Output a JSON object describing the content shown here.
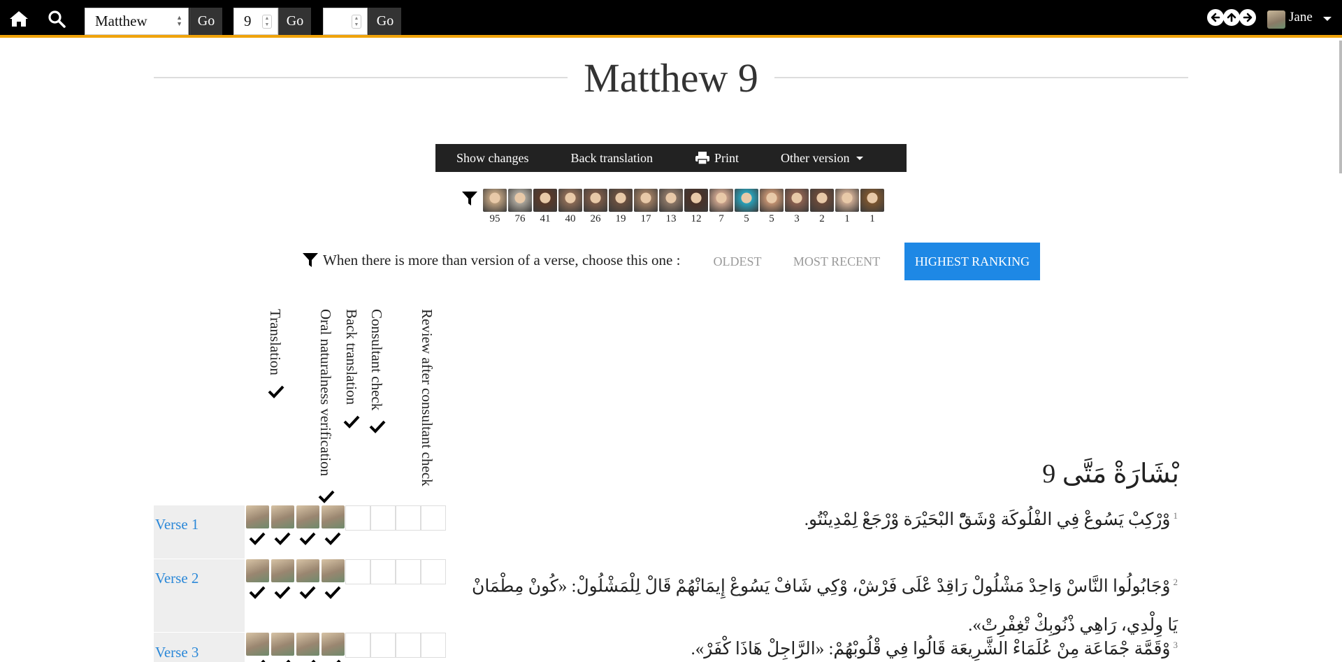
{
  "nav": {
    "book_value": "Matthew",
    "chapter_value": "9",
    "verse_value": "",
    "go_label": "Go",
    "user_name": "Jane"
  },
  "page": {
    "title": "Matthew 9"
  },
  "toolbar": {
    "show_changes": "Show changes",
    "back_translation": "Back translation",
    "print": "Print",
    "other_version": "Other version"
  },
  "contributors": {
    "counts": [
      "95",
      "76",
      "41",
      "40",
      "26",
      "19",
      "17",
      "13",
      "12",
      "7",
      "5",
      "5",
      "3",
      "2",
      "1",
      "1"
    ],
    "colors": [
      "#b89c7c",
      "#a9a49a",
      "#5a3a2a",
      "#8a6a55",
      "#7a5a48",
      "#6a5040",
      "#9a7a60",
      "#8a7565",
      "#4a3228",
      "#c7a08a",
      "#2aa0b8",
      "#c09070",
      "#8a6050",
      "#6a4a3a",
      "#c9a890",
      "#7a5530"
    ]
  },
  "version_choice": {
    "prompt": "When there is more than version of a verse, choose this one :",
    "oldest": "OLDEST",
    "most_recent": "MOST RECENT",
    "highest_ranking": "HIGHEST RANKING",
    "selected": "HIGHEST RANKING"
  },
  "stages": {
    "translation": "Translation",
    "oral": "Oral naturalness verification",
    "back": "Back translation",
    "consultant": "Consultant check",
    "review": "Review after consultant check"
  },
  "chapter": {
    "heading": "بْشَارَةْ مَتَّى 9"
  },
  "verses": [
    {
      "label": "Verse 1",
      "number": "1",
      "text": "وْرْكِبْ يَسُوعْ فِي الفْلُوكَة وْشَقّْ البْحَيْرَة وْرْجَعْ لِمْدِينْتُو."
    },
    {
      "label": "Verse 2",
      "number": "2",
      "text": "وْجَابُولُوا النَّاسْ وَاحِدْ مَشْلُولْ رَاقِدْ عْلَى فَرْشْ، وْكِي شَافْ يَسُوعْ إِيمَانْهُمْ قَالْ لِلْمَشْلُولْ: «كُونْ مِطْمَانْ يَا وِلْدِي، رَاهِي ذْنُوبِكْ تْغِفْرِتْ»."
    },
    {
      "label": "Verse 3",
      "number": "3",
      "text": "وْقَمَّة جْمَاعَة مِنْ عُلَمَاءْ الشَّرِيعَة قَالُوا فِي قْلُوبْهُمْ: «الرَّاجِلْ هَاذَا كْفَرْ»."
    }
  ]
}
